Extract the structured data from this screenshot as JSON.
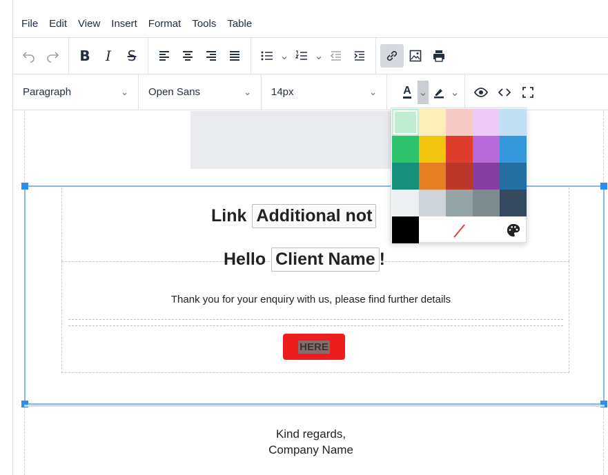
{
  "menubar": {
    "items": [
      "File",
      "Edit",
      "View",
      "Insert",
      "Format",
      "Tools",
      "Table"
    ]
  },
  "toolbar": {
    "block_format": "Paragraph",
    "font_family": "Open Sans",
    "font_size": "14px",
    "bold": "B",
    "italic": "I",
    "strike": "S",
    "text_color_letter": "A",
    "caret": "⌄"
  },
  "color_picker": {
    "colors": [
      "#BFEDD2",
      "#FBEEB8",
      "#F8CAC6",
      "#ECCAFA",
      "#C2E0F4",
      "#2DC26B",
      "#F1C40F",
      "#E03E2D",
      "#B96AD9",
      "#3598DB",
      "#169179",
      "#E67E23",
      "#BA372A",
      "#843FA1",
      "#236FA1",
      "#ECF0F1",
      "#CED4D9",
      "#95A5A6",
      "#7E8C8D",
      "#34495E",
      "#000000"
    ],
    "selected_index": 0,
    "remove_icon": "remove-color-icon",
    "custom_icon": "palette-icon"
  },
  "document": {
    "link_label": "Link",
    "link_field": "Additional not",
    "hello_label": "Hello",
    "client_field": "Client Name",
    "exclamation": "!",
    "body": "Thank you for your enquiry with us, please find further details",
    "cta_label": "HERE",
    "closing_line1": "Kind regards,",
    "closing_line2": "Company Name"
  },
  "colors": {
    "accent": "#2D8CF0",
    "cta_background": "#EE1D1D",
    "selection_border": "#8AB4EA"
  }
}
